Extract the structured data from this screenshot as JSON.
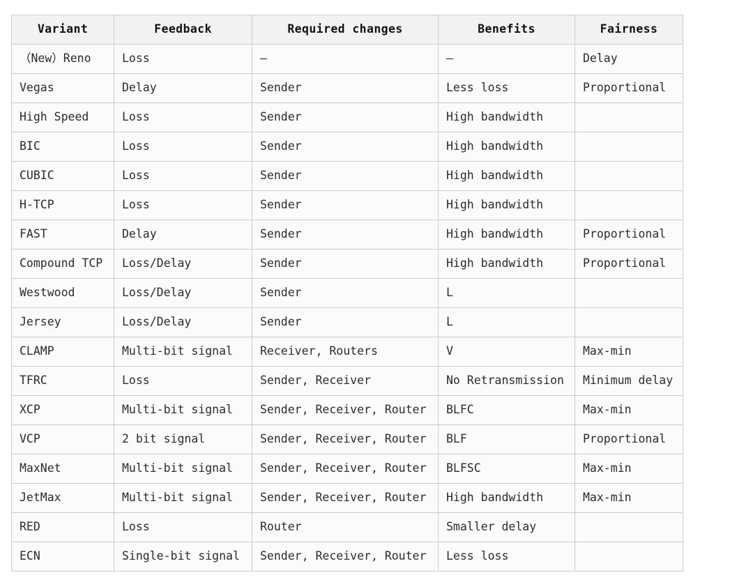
{
  "table": {
    "caption": "",
    "columns": [
      {
        "key": "variant",
        "label": "Variant"
      },
      {
        "key": "feedback",
        "label": "Feedback"
      },
      {
        "key": "changes",
        "label": "Required changes"
      },
      {
        "key": "benefits",
        "label": "Benefits"
      },
      {
        "key": "fairness",
        "label": "Fairness"
      }
    ],
    "rows": [
      {
        "variant": "（New）Reno",
        "feedback": "Loss",
        "changes": "–",
        "benefits": "–",
        "fairness": "Delay"
      },
      {
        "variant": "Vegas",
        "feedback": "Delay",
        "changes": "Sender",
        "benefits": "Less loss",
        "fairness": "Proportional"
      },
      {
        "variant": "High Speed",
        "feedback": "Loss",
        "changes": "Sender",
        "benefits": "High bandwidth",
        "fairness": ""
      },
      {
        "variant": "BIC",
        "feedback": "Loss",
        "changes": "Sender",
        "benefits": "High bandwidth",
        "fairness": ""
      },
      {
        "variant": "CUBIC",
        "feedback": "Loss",
        "changes": "Sender",
        "benefits": "High bandwidth",
        "fairness": ""
      },
      {
        "variant": "H-TCP",
        "feedback": "Loss",
        "changes": "Sender",
        "benefits": "High bandwidth",
        "fairness": ""
      },
      {
        "variant": "FAST",
        "feedback": "Delay",
        "changes": "Sender",
        "benefits": "High bandwidth",
        "fairness": "Proportional"
      },
      {
        "variant": "Compound TCP",
        "feedback": "Loss/Delay",
        "changes": "Sender",
        "benefits": "High bandwidth",
        "fairness": "Proportional"
      },
      {
        "variant": "Westwood",
        "feedback": "Loss/Delay",
        "changes": "Sender",
        "benefits": "L",
        "fairness": ""
      },
      {
        "variant": "Jersey",
        "feedback": "Loss/Delay",
        "changes": "Sender",
        "benefits": "L",
        "fairness": ""
      },
      {
        "variant": "CLAMP",
        "feedback": "Multi-bit signal",
        "changes": "Receiver, Routers",
        "benefits": "V",
        "fairness": "Max-min"
      },
      {
        "variant": "TFRC",
        "feedback": "Loss",
        "changes": "Sender, Receiver",
        "benefits": "No Retransmission",
        "fairness": "Minimum delay"
      },
      {
        "variant": "XCP",
        "feedback": "Multi-bit signal",
        "changes": "Sender, Receiver, Router",
        "benefits": "BLFC",
        "fairness": "Max-min"
      },
      {
        "variant": "VCP",
        "feedback": "2 bit signal",
        "changes": "Sender, Receiver, Router",
        "benefits": "BLF",
        "fairness": "Proportional"
      },
      {
        "variant": "MaxNet",
        "feedback": "Multi-bit signal",
        "changes": "Sender, Receiver, Router",
        "benefits": "BLFSC",
        "fairness": "Max-min"
      },
      {
        "variant": "JetMax",
        "feedback": "Multi-bit signal",
        "changes": "Sender, Receiver, Router",
        "benefits": "High bandwidth",
        "fairness": "Max-min"
      },
      {
        "variant": "RED",
        "feedback": "Loss",
        "changes": "Router",
        "benefits": "Smaller delay",
        "fairness": ""
      },
      {
        "variant": "ECN",
        "feedback": "Single-bit signal",
        "changes": "Sender, Receiver, Router",
        "benefits": "Less loss",
        "fairness": ""
      }
    ]
  },
  "colors": {
    "page_background": "#ffffff",
    "header_background": "#f2f2f2",
    "row_background": "#fbfbfb",
    "border": "#cccccc",
    "header_text": "#111111",
    "body_text": "#2b2b2b"
  }
}
